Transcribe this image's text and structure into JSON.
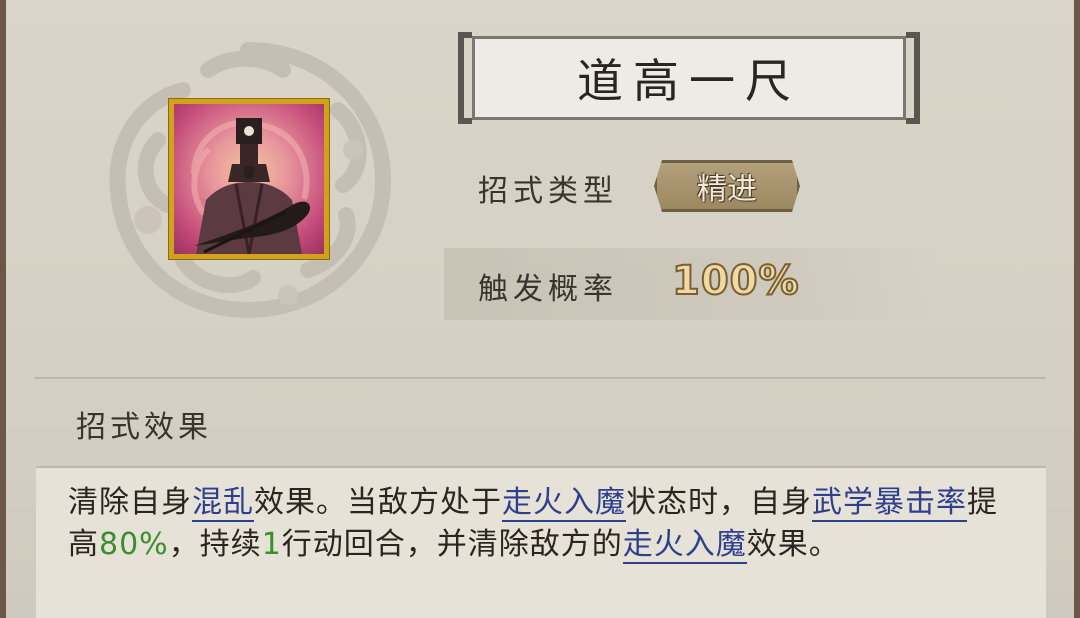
{
  "skill": {
    "title": "道高一尺",
    "portrait_icon": "elder-sage-portrait-icon",
    "type_label": "招式类型",
    "type_value": "精进",
    "rate_label": "触发概率",
    "rate_value": "100%"
  },
  "effect": {
    "section_title": "招式效果",
    "segments": [
      {
        "t": "清除自身",
        "k": "plain"
      },
      {
        "t": "混乱",
        "k": "kw"
      },
      {
        "t": "效果。当敌方处于",
        "k": "plain"
      },
      {
        "t": "走火入魔",
        "k": "kw"
      },
      {
        "t": "状态时，自身",
        "k": "plain"
      },
      {
        "t": "武学暴击率",
        "k": "kw"
      },
      {
        "t": "提高",
        "k": "plain"
      },
      {
        "t": "80%",
        "k": "num"
      },
      {
        "t": "，持续",
        "k": "plain"
      },
      {
        "t": "1",
        "k": "num"
      },
      {
        "t": "行动回合，并清除敌方的",
        "k": "plain"
      },
      {
        "t": "走火入魔",
        "k": "kw"
      },
      {
        "t": "效果。",
        "k": "plain"
      }
    ]
  },
  "colors": {
    "keyword": "#2e3f8c",
    "number": "#3a8e2e",
    "portrait_frame": "#d3a21c",
    "badge": "#a8946c"
  }
}
